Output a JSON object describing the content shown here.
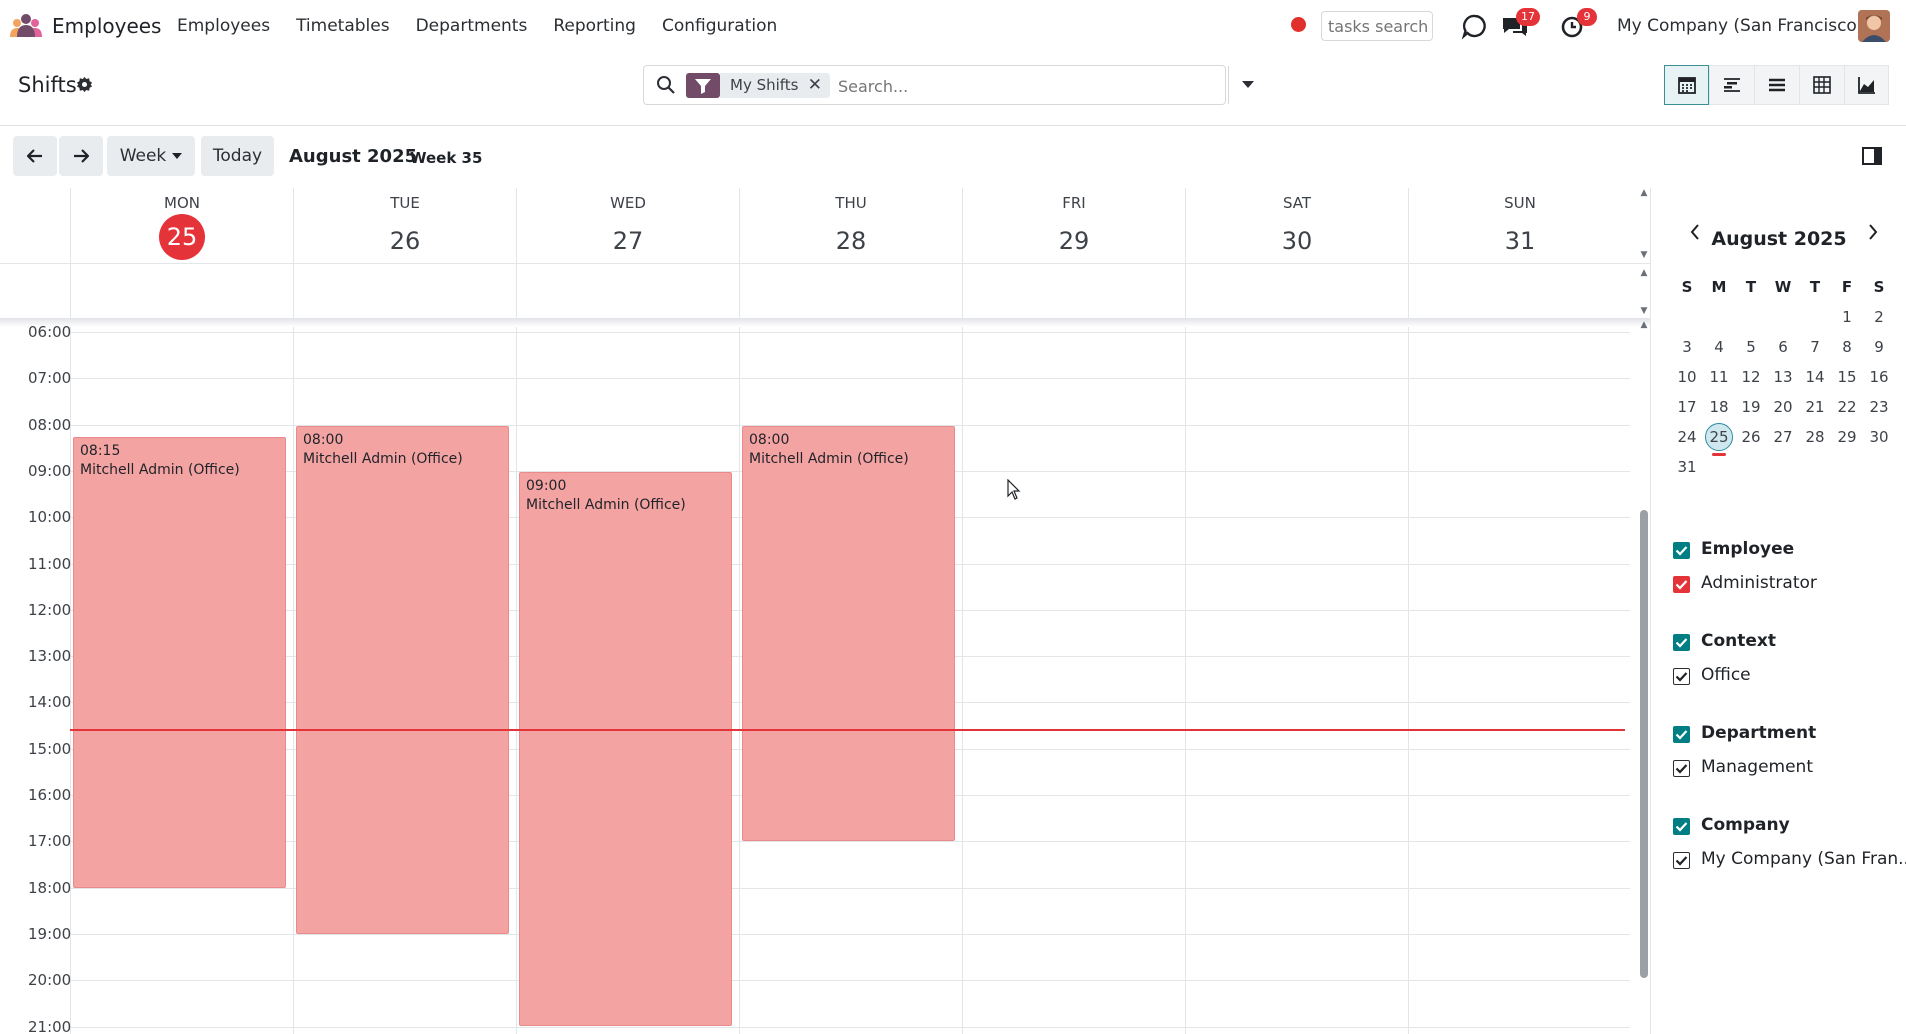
{
  "navbar": {
    "app_name": "Employees",
    "menu": [
      "Employees",
      "Timetables",
      "Departments",
      "Reporting",
      "Configuration"
    ],
    "tasks_search_placeholder": "tasks search",
    "messages_badge": "17",
    "activities_badge": "9",
    "company": "My Company (San Francisco)"
  },
  "control": {
    "title": "Shifts",
    "facet_label": "My Shifts",
    "search_placeholder": "Search...",
    "views": [
      "calendar-icon",
      "gantt-icon",
      "list-icon",
      "pivot-icon",
      "graph-icon"
    ],
    "active_view": "calendar-icon"
  },
  "toolbar": {
    "prev": "←",
    "next": "→",
    "scale": "Week",
    "today": "Today",
    "range": "August 2025",
    "week": "Week 35"
  },
  "calendar": {
    "days": [
      {
        "name": "MON",
        "num": "25",
        "today": true
      },
      {
        "name": "TUE",
        "num": "26",
        "today": false
      },
      {
        "name": "WED",
        "num": "27",
        "today": false
      },
      {
        "name": "THU",
        "num": "28",
        "today": false
      },
      {
        "name": "FRI",
        "num": "29",
        "today": false
      },
      {
        "name": "SAT",
        "num": "30",
        "today": false
      },
      {
        "name": "SUN",
        "num": "31",
        "today": false
      }
    ],
    "hours": [
      "06:00",
      "07:00",
      "08:00",
      "09:00",
      "10:00",
      "11:00",
      "12:00",
      "13:00",
      "14:00",
      "15:00",
      "16:00",
      "17:00",
      "18:00",
      "19:00",
      "20:00",
      "21:00"
    ],
    "events": [
      {
        "day": 0,
        "start": "08:15",
        "end": "18:00",
        "title": "Mitchell Admin (Office)"
      },
      {
        "day": 1,
        "start": "08:00",
        "end": "19:00",
        "title": "Mitchell Admin (Office)"
      },
      {
        "day": 2,
        "start": "09:00",
        "end": "21:00",
        "title": "Mitchell Admin (Office)"
      },
      {
        "day": 3,
        "start": "08:00",
        "end": "17:00",
        "title": "Mitchell Admin (Office)"
      }
    ],
    "now": "14:35"
  },
  "mini_calendar": {
    "title": "August 2025",
    "weekdays": [
      "S",
      "M",
      "T",
      "W",
      "T",
      "F",
      "S"
    ],
    "weeks": [
      [
        "",
        "",
        "",
        "",
        "",
        "1",
        "2"
      ],
      [
        "3",
        "4",
        "5",
        "6",
        "7",
        "8",
        "9"
      ],
      [
        "10",
        "11",
        "12",
        "13",
        "14",
        "15",
        "16"
      ],
      [
        "17",
        "18",
        "19",
        "20",
        "21",
        "22",
        "23"
      ],
      [
        "24",
        "25",
        "26",
        "27",
        "28",
        "29",
        "30"
      ],
      [
        "31",
        "",
        "",
        "",
        "",
        "",
        ""
      ]
    ],
    "today": "25"
  },
  "filters": [
    {
      "header": "Employee",
      "item": "Administrator",
      "item_style": "red"
    },
    {
      "header": "Context",
      "item": "Office",
      "item_style": "outline"
    },
    {
      "header": "Department",
      "item": "Management",
      "item_style": "outline"
    },
    {
      "header": "Company",
      "item": "My Company (San Fran...",
      "item_style": "outline"
    }
  ],
  "colors": {
    "accent": "#714b67",
    "event": "#f4a3a3",
    "today": "#e5333a",
    "teal": "#017e84"
  }
}
